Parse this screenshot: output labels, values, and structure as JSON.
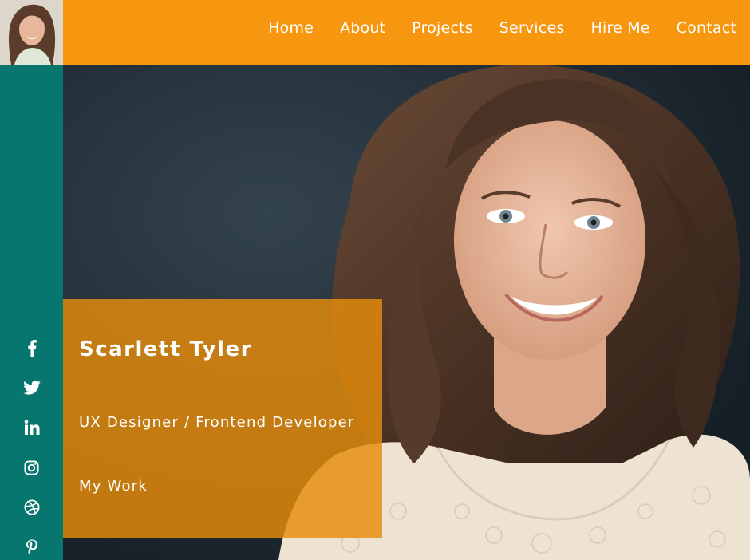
{
  "nav": {
    "items": [
      {
        "label": "Home"
      },
      {
        "label": "About"
      },
      {
        "label": "Projects"
      },
      {
        "label": "Services"
      },
      {
        "label": "Hire Me"
      },
      {
        "label": "Contact"
      }
    ]
  },
  "hero": {
    "name": "Scarlett Tyler",
    "role": "UX Designer / Frontend Developer",
    "cta": "My Work"
  },
  "social": {
    "icons": [
      "facebook-icon",
      "twitter-icon",
      "linkedin-icon",
      "instagram-icon",
      "dribbble-icon",
      "pinterest-icon"
    ]
  },
  "colors": {
    "topbar": "#f7960f",
    "sidebar": "#06766e",
    "card": "#e68c0a",
    "text": "#ffffff"
  }
}
